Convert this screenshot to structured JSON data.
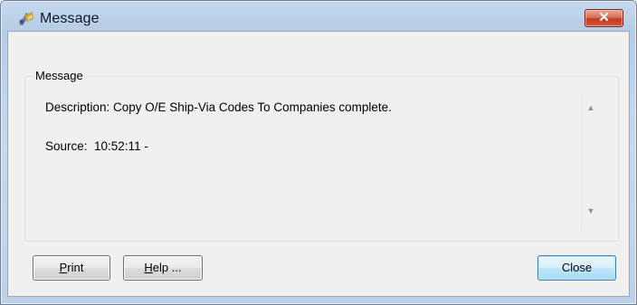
{
  "window": {
    "title": "Message",
    "close_glyph": "✕"
  },
  "group": {
    "label": "Message"
  },
  "message": {
    "description": "Description: Copy O/E Ship-Via Codes To Companies complete.",
    "source": "Source:  10:52:11 -"
  },
  "buttons": {
    "print": {
      "pre": "",
      "accel": "P",
      "post": "rint"
    },
    "help": {
      "pre": "",
      "accel": "H",
      "post": "elp ..."
    },
    "close": "Close"
  },
  "scroll": {
    "up": "▲",
    "down": "▼"
  },
  "icons": {
    "app_icon": "app-icon",
    "title_close": "close-icon"
  },
  "colors": {
    "title_close_red": "#c43b1e",
    "default_button_border": "#3c7fb1"
  }
}
